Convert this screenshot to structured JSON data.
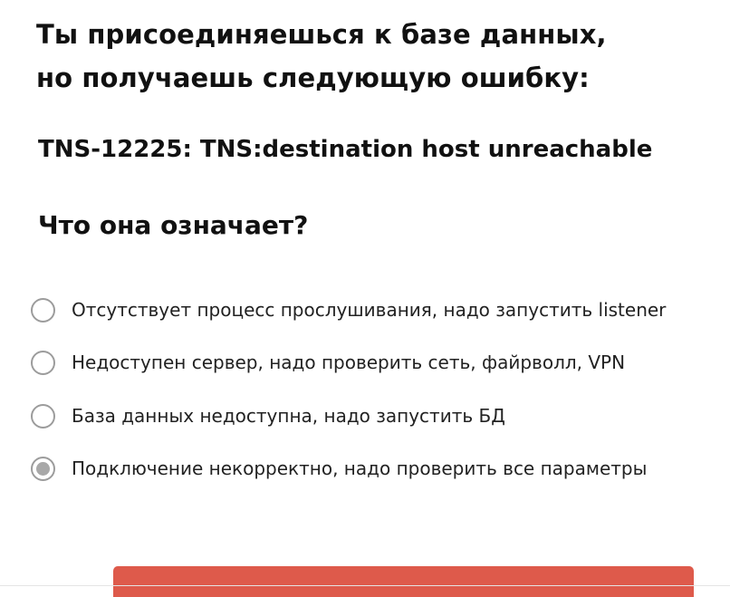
{
  "question": {
    "title_line1": "Ты присоединяешься к базе данных,",
    "title_line2": "но получаешь следующую ошибку:",
    "error": "TNS-12225: TNS:destination host unreachable",
    "prompt": "Что она означает?"
  },
  "options": [
    {
      "label": "Отсутствует процесс прослушивания, надо запустить listener",
      "selected": false
    },
    {
      "label": "Недоступен сервер, надо проверить сеть, файрволл, VPN",
      "selected": false
    },
    {
      "label": "База данных недоступна, надо запустить БД",
      "selected": false
    },
    {
      "label": "Подключение некорректно, надо проверить все параметры",
      "selected": true
    }
  ],
  "colors": {
    "accent": "#de5a4b",
    "radio_border": "#9c9c9c",
    "radio_selected": "#a8a8a8"
  },
  "icons": {
    "radio_unchecked": "radio-unchecked-icon",
    "radio_checked": "radio-checked-icon"
  }
}
